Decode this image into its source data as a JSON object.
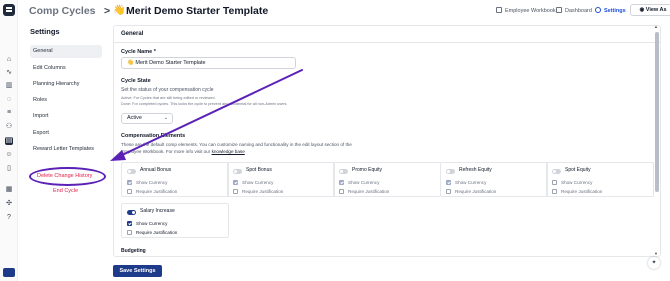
{
  "colors": {
    "accent": "#1e3a8a",
    "danger": "#e11d48",
    "annotation": "#5b21b6",
    "active_nav": "#1d4ed8"
  },
  "header": {
    "parent": "Comp Cycles",
    "separator": ">",
    "emoji": "👋",
    "title": "Merit Demo Starter Template",
    "nav": [
      "Employee Workbook",
      "Dashboard",
      "Settings"
    ],
    "view_as": "View As"
  },
  "sidebar": {
    "title": "Settings",
    "items": [
      "General",
      "Edit Columns",
      "Planning Hierarchy",
      "Roles",
      "Import",
      "Export",
      "Reward Letter Templates"
    ],
    "delete_link": "Delete Change History",
    "end_link": "End Cycle"
  },
  "main": {
    "section_title": "General",
    "cycle_name_label": "Cycle Name *",
    "cycle_name_value": "👋 Merit Demo Starter Template",
    "cycle_state_label": "Cycle State",
    "cycle_state_desc": "Set the status of your compensation cycle",
    "cycle_state_note1": "Active: For Cycles that are still being edited or reviewed.",
    "cycle_state_note2": "Done: For completed cycles. This locks the cycle to prevent any accidental for all non-Admin users.",
    "cycle_state_value": "Active",
    "comp_label": "Compensation Elements",
    "comp_desc1": "These are the default comp elements. You can customize naming and functionality in the edit layout section of the",
    "comp_desc2_pre": "Employee Workbook. For more info visit our",
    "comp_desc2_link": "knowledge base",
    "budgeting_label": "Budgeting",
    "elements": [
      {
        "name": "Annual Bonus",
        "on": false,
        "show_currency": "Show Currency",
        "show_checked": true,
        "require": "Require Justification",
        "require_checked": false
      },
      {
        "name": "Spot Bonus",
        "on": false,
        "show_currency": "Show Currency",
        "show_checked": true,
        "require": "Require Justification",
        "require_checked": false
      },
      {
        "name": "Promo Equity",
        "on": false,
        "show_currency": "Show Currency",
        "show_checked": true,
        "require": "Require Justification",
        "require_checked": false
      },
      {
        "name": "Refresh Equity",
        "on": false,
        "show_currency": "Show Currency",
        "show_checked": true,
        "require": "Require Justification",
        "require_checked": false
      },
      {
        "name": "Spot Equity",
        "on": false,
        "show_currency": "Show Currency",
        "show_checked": false,
        "require": "Require Justification",
        "require_checked": false
      },
      {
        "name": "Salary Increase",
        "on": true,
        "show_currency": "Show Currency",
        "show_checked": true,
        "require": "Require Justification",
        "require_checked": false
      }
    ]
  },
  "footer": {
    "save": "Save Settings"
  }
}
